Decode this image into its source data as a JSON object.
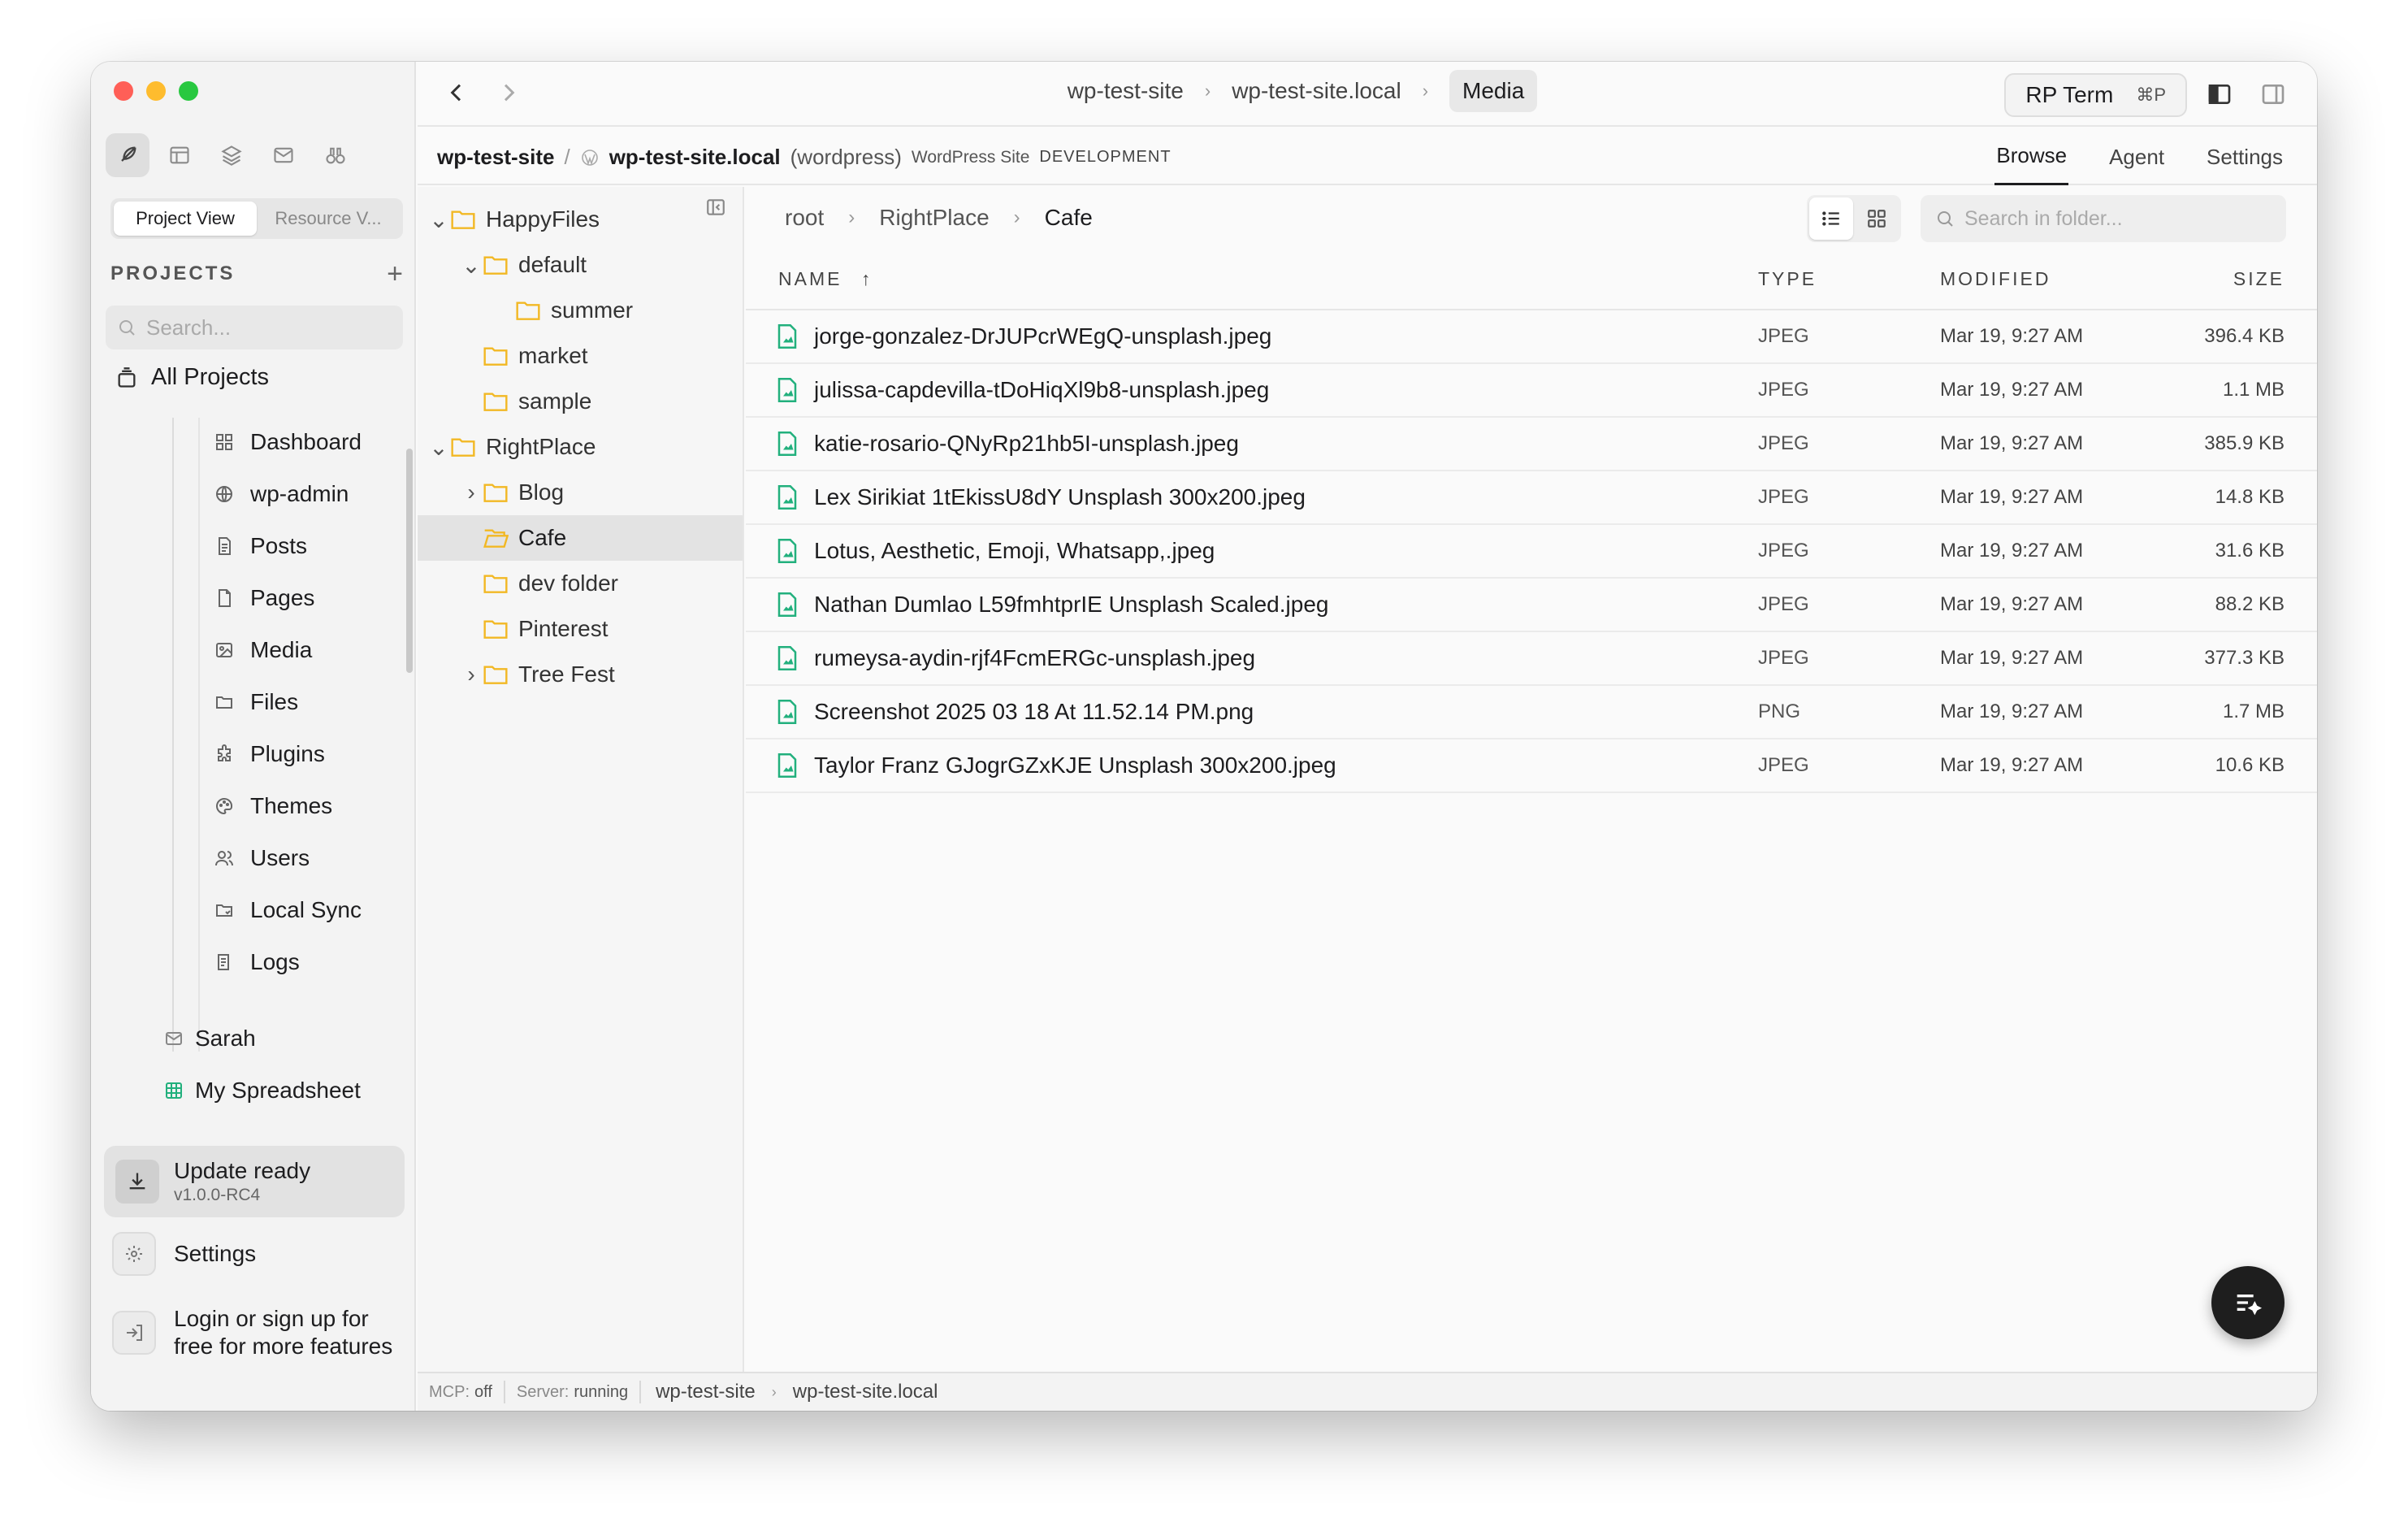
{
  "sidebar": {
    "view_tabs": [
      "Project View",
      "Resource V..."
    ],
    "projects_heading": "PROJECTS",
    "add_symbol": "+",
    "search_placeholder": "Search...",
    "all_projects": "All Projects",
    "nav_items": [
      {
        "label": "Dashboard",
        "icon": "dashboard-icon"
      },
      {
        "label": "wp-admin",
        "icon": "globe-icon"
      },
      {
        "label": "Posts",
        "icon": "document-icon"
      },
      {
        "label": "Pages",
        "icon": "page-icon"
      },
      {
        "label": "Media",
        "icon": "image-icon"
      },
      {
        "label": "Files",
        "icon": "folder-icon"
      },
      {
        "label": "Plugins",
        "icon": "puzzle-icon"
      },
      {
        "label": "Themes",
        "icon": "palette-icon"
      },
      {
        "label": "Users",
        "icon": "users-icon"
      },
      {
        "label": "Local Sync",
        "icon": "sync-icon"
      },
      {
        "label": "Logs",
        "icon": "logs-icon"
      }
    ],
    "sub_items": [
      {
        "label": "Sarah",
        "icon": "mail-icon"
      },
      {
        "label": "My Spreadsheet",
        "icon": "spreadsheet-icon"
      }
    ],
    "update": {
      "title": "Update ready",
      "version": "v1.0.0-RC4"
    },
    "settings_label": "Settings",
    "login_text": "Login or sign up for free for more features"
  },
  "titlebar": {
    "breadcrumbs": [
      "wp-test-site",
      "wp-test-site.local",
      "Media"
    ],
    "rp_term": {
      "label": "RP Term",
      "shortcut": "⌘P"
    }
  },
  "sitebar": {
    "site": "wp-test-site",
    "separator": "/",
    "local_domain": "wp-test-site.local",
    "platform": "(wordpress)",
    "site_type": "WordPress Site",
    "environment": "DEVELOPMENT",
    "tabs": [
      "Browse",
      "Agent",
      "Settings"
    ]
  },
  "folder_tree": [
    {
      "label": "HappyFiles",
      "level": 0,
      "expanded": true
    },
    {
      "label": "default",
      "level": 1,
      "expanded": true
    },
    {
      "label": "summer",
      "level": 2
    },
    {
      "label": "market",
      "level": 1
    },
    {
      "label": "sample",
      "level": 1
    },
    {
      "label": "RightPlace",
      "level": 0,
      "expanded": true
    },
    {
      "label": "Blog",
      "level": 1,
      "collapsed": true
    },
    {
      "label": "Cafe",
      "level": 1,
      "selected": true
    },
    {
      "label": "dev folder",
      "level": 1
    },
    {
      "label": "Pinterest",
      "level": 1
    },
    {
      "label": "Tree Fest",
      "level": 1,
      "collapsed": true
    }
  ],
  "main": {
    "path": [
      "root",
      "RightPlace",
      "Cafe"
    ],
    "search_placeholder": "Search in folder...",
    "columns": {
      "name": "NAME",
      "type": "TYPE",
      "modified": "MODIFIED",
      "size": "SIZE"
    },
    "sort_indicator": "↑",
    "files": [
      {
        "name": "jorge-gonzalez-DrJUPcrWEgQ-unsplash.jpeg",
        "type": "JPEG",
        "modified": "Mar 19, 9:27 AM",
        "size": "396.4 KB"
      },
      {
        "name": "julissa-capdevilla-tDoHiqXl9b8-unsplash.jpeg",
        "type": "JPEG",
        "modified": "Mar 19, 9:27 AM",
        "size": "1.1 MB"
      },
      {
        "name": "katie-rosario-QNyRp21hb5I-unsplash.jpeg",
        "type": "JPEG",
        "modified": "Mar 19, 9:27 AM",
        "size": "385.9 KB"
      },
      {
        "name": "Lex Sirikiat 1tEkissU8dY Unsplash 300x200.jpeg",
        "type": "JPEG",
        "modified": "Mar 19, 9:27 AM",
        "size": "14.8 KB"
      },
      {
        "name": "Lotus, Aesthetic, Emoji, Whatsapp,.jpeg",
        "type": "JPEG",
        "modified": "Mar 19, 9:27 AM",
        "size": "31.6 KB"
      },
      {
        "name": "Nathan Dumlao L59fmhtprIE Unsplash Scaled.jpeg",
        "type": "JPEG",
        "modified": "Mar 19, 9:27 AM",
        "size": "88.2 KB"
      },
      {
        "name": "rumeysa-aydin-rjf4FcmERGc-unsplash.jpeg",
        "type": "JPEG",
        "modified": "Mar 19, 9:27 AM",
        "size": "377.3 KB"
      },
      {
        "name": "Screenshot 2025 03 18 At 11.52.14 PM.png",
        "type": "PNG",
        "modified": "Mar 19, 9:27 AM",
        "size": "1.7 MB"
      },
      {
        "name": "Taylor Franz GJogrGZxKJE Unsplash 300x200.jpeg",
        "type": "JPEG",
        "modified": "Mar 19, 9:27 AM",
        "size": "10.6 KB"
      }
    ]
  },
  "statusbar": {
    "mcp_label": "MCP:",
    "mcp_value": "off",
    "server_label": "Server:",
    "server_value": "running",
    "trail": [
      "wp-test-site",
      "wp-test-site.local"
    ]
  },
  "colors": {
    "file_icon": "#22b07d",
    "folder_icon": "#f2b824",
    "fab": "#1e1e1e"
  }
}
